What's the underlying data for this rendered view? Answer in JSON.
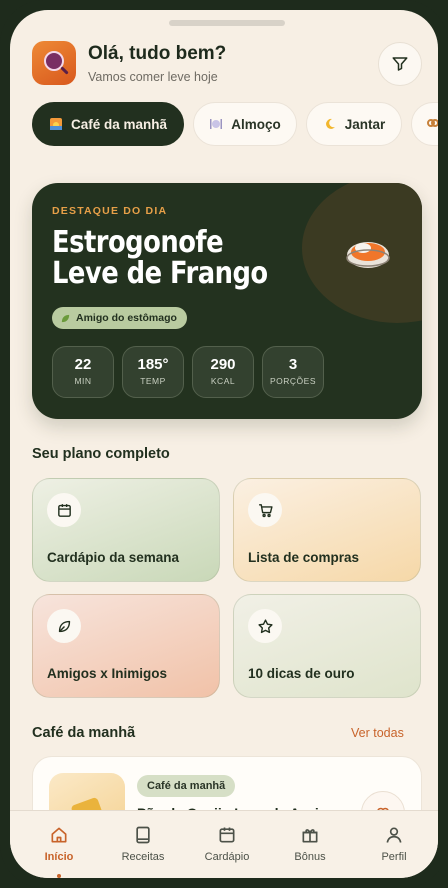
{
  "header": {
    "greeting": "Olá, tudo bem?",
    "subtitle": "Vamos comer leve hoje",
    "filter_icon": "filter-icon"
  },
  "meal_chips": [
    {
      "label": "Café da manhã",
      "icon": "sunrise-icon",
      "active": true
    },
    {
      "label": "Almoço",
      "icon": "plate-icon",
      "active": false
    },
    {
      "label": "Jantar",
      "icon": "moon-icon",
      "active": false
    },
    {
      "label": "",
      "icon": "pretzel-icon",
      "active": false
    }
  ],
  "featured": {
    "kicker": "DESTAQUE DO DIA",
    "title": "Estrogonofe Leve de Frango",
    "badge": "Amigo do estômago",
    "badge_icon": "leaf-icon",
    "stats": [
      {
        "value": "22",
        "label": "MIN"
      },
      {
        "value": "185°",
        "label": "TEMP"
      },
      {
        "value": "290",
        "label": "KCAL"
      },
      {
        "value": "3",
        "label": "PORÇÕES"
      }
    ]
  },
  "plan": {
    "title": "Seu plano completo",
    "tiles": [
      {
        "label": "Cardápio da semana",
        "icon": "calendar-icon"
      },
      {
        "label": "Lista de compras",
        "icon": "cart-icon"
      },
      {
        "label": "Amigos x Inimigos",
        "icon": "leaf-icon"
      },
      {
        "label": "10 dicas de ouro",
        "icon": "star-icon"
      }
    ]
  },
  "breakfast": {
    "title": "Café da manhã",
    "see_all": "Ver todas",
    "recipe": {
      "tag": "Café da manhã",
      "name": "Pão de Queijo Leve de Aveia"
    }
  },
  "tabbar": [
    {
      "label": "Início",
      "icon": "home-icon",
      "active": true
    },
    {
      "label": "Receitas",
      "icon": "book-icon",
      "active": false
    },
    {
      "label": "Cardápio",
      "icon": "calendar-icon",
      "active": false
    },
    {
      "label": "Bônus",
      "icon": "gift-icon",
      "active": false
    },
    {
      "label": "Perfil",
      "icon": "user-icon",
      "active": false
    }
  ],
  "colors": {
    "primary_dark": "#22301f",
    "accent": "#c8632a",
    "kicker": "#e7a048",
    "background": "#f7efe4"
  }
}
